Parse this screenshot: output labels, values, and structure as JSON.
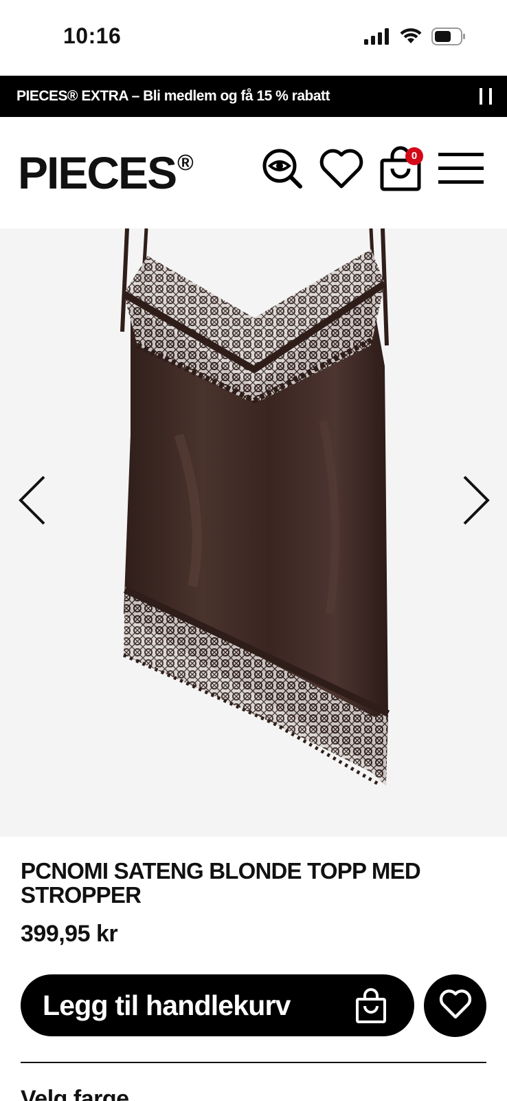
{
  "status": {
    "time": "10:16"
  },
  "promo": {
    "text": "PIECES® EXTRA – Bli medlem og få 15 % rabatt"
  },
  "header": {
    "brand": "PIECES",
    "brand_mark": "®",
    "cart_count": "0"
  },
  "gallery": {
    "image_description_icon": "lace-camisole-product-image"
  },
  "product": {
    "title": "PCNOMI SATENG BLONDE TOPP MED STROPPER",
    "price": "399,95 kr",
    "add_to_cart_label": "Legg til handlekurv",
    "color_label": "Velg farge"
  },
  "colors": {
    "promo_bg": "#000000",
    "badge": "#d40918",
    "gallery_bg": "#f4f4f4",
    "product": "#3a2521"
  }
}
